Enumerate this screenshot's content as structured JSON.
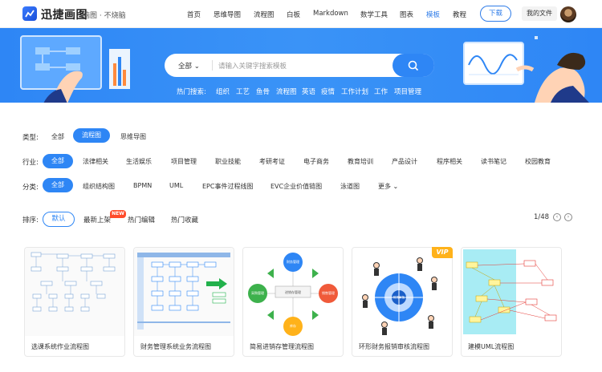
{
  "header": {
    "brand": "迅捷画图",
    "slogan": "脑图 · 不烧脑",
    "nav": [
      "首页",
      "思维导图",
      "流程图",
      "白板",
      "Markdown",
      "数学工具",
      "图表",
      "模板",
      "教程"
    ],
    "active_nav": "模板",
    "download_label": "下载",
    "myfile_label": "我的文件"
  },
  "search": {
    "category": "全部",
    "placeholder": "请输入关键字搜索模板",
    "hot_label": "热门搜索:",
    "hot_terms": [
      "组织",
      "工艺",
      "鱼骨",
      "流程图",
      "英语",
      "疫情",
      "工作计划",
      "工作",
      "项目管理"
    ]
  },
  "filters": {
    "type_label": "类型:",
    "type_chips": [
      "全部",
      "流程图",
      "思维导图"
    ],
    "type_selected": "流程图",
    "industry_label": "行业:",
    "industry_chips": [
      "全部",
      "法律相关",
      "生活娱乐",
      "项目管理",
      "职业技能",
      "考研考证",
      "电子商务",
      "教育培训",
      "产品设计",
      "程序相关",
      "读书笔记",
      "校园教育"
    ],
    "category_label": "分类:",
    "category_chips": [
      "全部",
      "组织结构图",
      "BPMN",
      "UML",
      "EPC事件过程线图",
      "EVC企业价值链图",
      "泳道图",
      "更多"
    ]
  },
  "sort": {
    "label": "排序:",
    "options": [
      "默认",
      "最新上架",
      "热门编辑",
      "热门收藏"
    ],
    "new_badge": "NEW",
    "page": "1/48"
  },
  "cards": [
    {
      "title": "选课系统作业流程图"
    },
    {
      "title": "财务管理系统业务流程图"
    },
    {
      "title": "简易进销存管理流程图"
    },
    {
      "title": "环形财务报销审核流程图",
      "vip": "VIP"
    },
    {
      "title": "建模UML流程图"
    }
  ],
  "thumb_text": {
    "finance": "财务管理",
    "purchase": "采购管理",
    "sales": "销售管理",
    "stock": "库存",
    "center": "进销存管理",
    "approve": "财务审批"
  },
  "colors": {
    "accent": "#2e86f5",
    "hero": "#3a93f7",
    "new_badge": "#ff4b2b",
    "vip": "#ffb21a"
  },
  "icons": [
    "logo-icon",
    "search-icon",
    "chevron-down-icon",
    "prev-page-icon",
    "next-page-icon",
    "avatar"
  ]
}
